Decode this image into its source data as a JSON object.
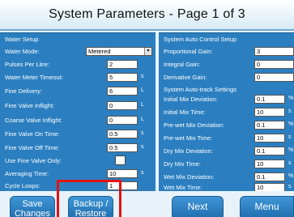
{
  "title": "System Parameters - Page 1 of 3",
  "water_setup": {
    "heading": "Water Setup",
    "rows": [
      {
        "label": "Water Mode:",
        "value": "Metered",
        "unit": ""
      },
      {
        "label": "Pulses Per Litre:",
        "value": "2",
        "unit": ""
      },
      {
        "label": "Water Meter Timeout:",
        "value": "5",
        "unit": "s"
      },
      {
        "label": "Fine Delivery:",
        "value": "6",
        "unit": "L"
      },
      {
        "label": "Fine Valve Inflight:",
        "value": "0",
        "unit": "L"
      },
      {
        "label": "Coarse Valve Inflight:",
        "value": "0",
        "unit": "L"
      },
      {
        "label": "Fine Valve On Time:",
        "value": "0.5",
        "unit": "s"
      },
      {
        "label": "Fine Valve Off Time:",
        "value": "0.5",
        "unit": "s"
      },
      {
        "label": "Use Fine Valve Only:",
        "value": "",
        "unit": ""
      },
      {
        "label": "Averaging Time:",
        "value": "10",
        "unit": "s"
      },
      {
        "label": "Cycle Loops:",
        "value": "1",
        "unit": ""
      }
    ]
  },
  "auto_control": {
    "heading": "System Auto Control Setup",
    "rows": [
      {
        "label": "Proportional Gain:",
        "value": "3"
      },
      {
        "label": "Integral Gain:",
        "value": "0"
      },
      {
        "label": "Derivative Gain:",
        "value": "0"
      }
    ]
  },
  "auto_track": {
    "heading": "System Auto-track Settings",
    "rows": [
      {
        "label": "Initial Mix Deviation:",
        "value": "0.1",
        "unit": "%"
      },
      {
        "label": "Initial Mix Time:",
        "value": "10",
        "unit": "s"
      },
      {
        "label": "Pre-wet Mix Deviation:",
        "value": "0.1",
        "unit": "%"
      },
      {
        "label": "Pre-wet Mix Time:",
        "value": "10",
        "unit": "s"
      },
      {
        "label": "Dry Mix Deviation:",
        "value": "0.1",
        "unit": "%"
      },
      {
        "label": "Dry Mix Time:",
        "value": "10",
        "unit": "s"
      },
      {
        "label": "Wet Mix Deviation:",
        "value": "0.1",
        "unit": "%"
      },
      {
        "label": "Wet Mix Time:",
        "value": "10",
        "unit": "s"
      }
    ]
  },
  "footer": {
    "save_line1": "Save",
    "save_line2": "Changes",
    "backup_line1": "Backup /",
    "backup_line2": "Restore",
    "next": "Next",
    "menu": "Menu"
  },
  "colors": {
    "panel": "#2b7fc0",
    "highlight": "#e31212"
  }
}
